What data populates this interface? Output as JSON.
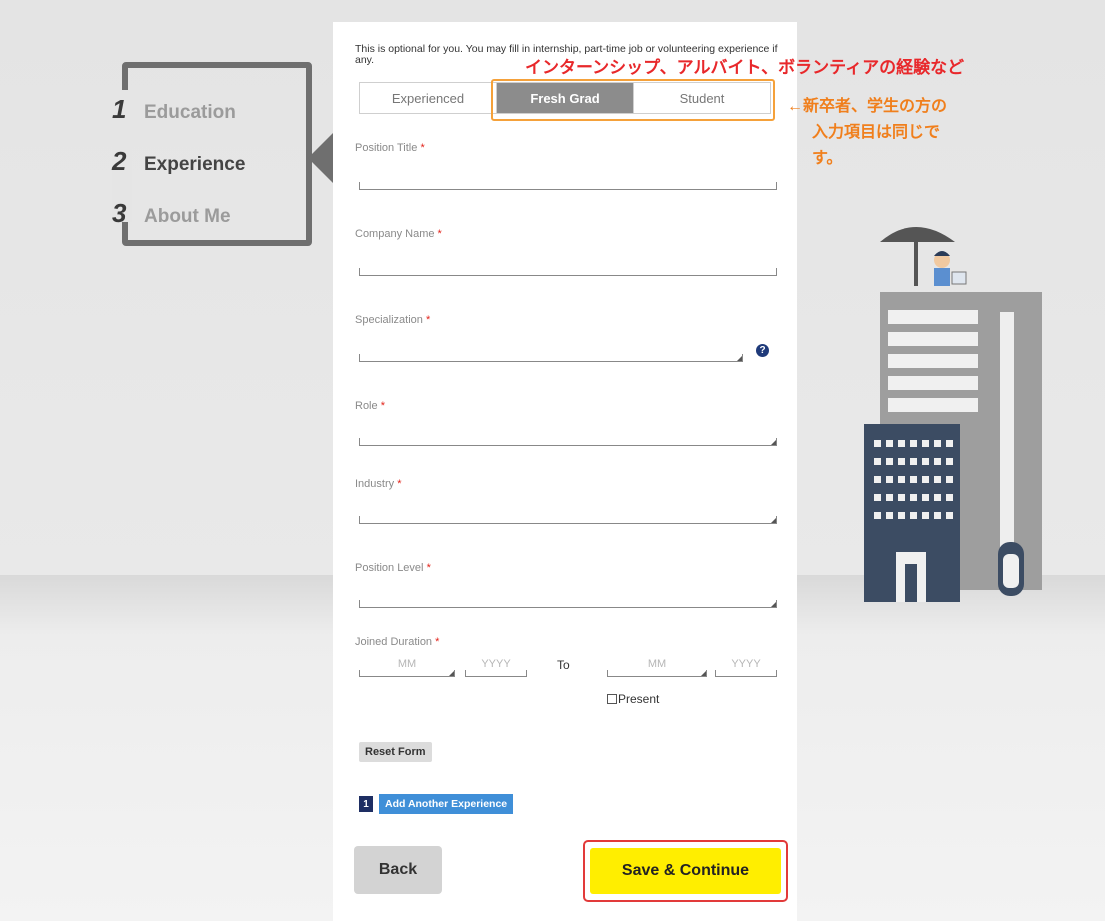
{
  "steps": [
    {
      "num": "1",
      "label": "Education"
    },
    {
      "num": "2",
      "label": "Experience"
    },
    {
      "num": "3",
      "label": "About Me"
    }
  ],
  "note": "This is optional for you. You may fill in internship, part-time job or volunteering experience if any.",
  "annotations": {
    "jp_internship": "インターンシップ、アルバイト、ボランティアの経験など",
    "jp_same_line1": "←新卒者、学生の方の",
    "jp_same_line2": "入力項目は同じです。"
  },
  "tabs": [
    "Experienced",
    "Fresh Grad",
    "Student"
  ],
  "active_tab": "Fresh Grad",
  "fields": {
    "position_title": "Position Title",
    "company_name": "Company Name",
    "specialization": "Specialization",
    "role": "Role",
    "industry": "Industry",
    "position_level": "Position Level",
    "joined_duration": "Joined Duration",
    "required_mark": "*"
  },
  "help_icon": "?",
  "date": {
    "from_month_placeholder": "MM",
    "from_year_placeholder": "YYYY",
    "to_label": "To",
    "to_month_placeholder": "MM",
    "to_year_placeholder": "YYYY",
    "present_label": "Present"
  },
  "buttons": {
    "reset": "Reset Form",
    "experience_count": "1",
    "add_another": "Add Another Experience",
    "back": "Back",
    "save": "Save & Continue"
  },
  "colors": {
    "active_tab": "#8c8c8c",
    "save": "#ffee00",
    "add": "#3f8fd8",
    "required": "#e2231a",
    "annotation_red": "#e8282b",
    "annotation_orange": "#f07f1c"
  }
}
